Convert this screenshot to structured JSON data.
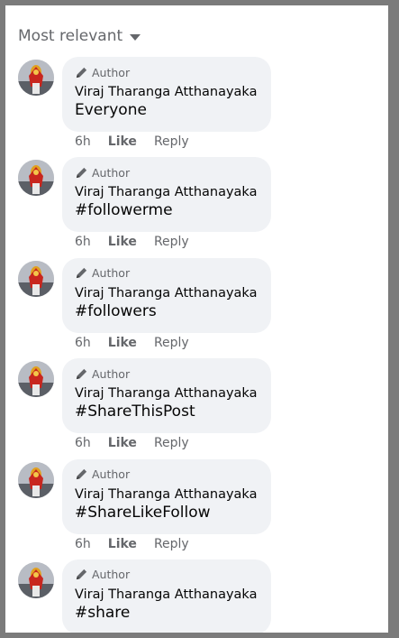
{
  "sort_label": "Most relevant",
  "comments": [
    {
      "author_badge": "Author",
      "author_name": "Viraj Tharanga Atthanayaka",
      "text": "Everyone",
      "time": "6h",
      "like_label": "Like",
      "reply_label": "Reply"
    },
    {
      "author_badge": "Author",
      "author_name": "Viraj Tharanga Atthanayaka",
      "text": "#followerme",
      "time": "6h",
      "like_label": "Like",
      "reply_label": "Reply"
    },
    {
      "author_badge": "Author",
      "author_name": "Viraj Tharanga Atthanayaka",
      "text": "#followers",
      "time": "6h",
      "like_label": "Like",
      "reply_label": "Reply"
    },
    {
      "author_badge": "Author",
      "author_name": "Viraj Tharanga Atthanayaka",
      "text": "#ShareThisPost",
      "time": "6h",
      "like_label": "Like",
      "reply_label": "Reply"
    },
    {
      "author_badge": "Author",
      "author_name": "Viraj Tharanga Atthanayaka",
      "text": "#ShareLikeFollow",
      "time": "6h",
      "like_label": "Like",
      "reply_label": "Reply"
    },
    {
      "author_badge": "Author",
      "author_name": "Viraj Tharanga Atthanayaka",
      "text": "#share",
      "time": "",
      "like_label": "",
      "reply_label": ""
    }
  ],
  "icons": {
    "author_badge": "pencil-icon",
    "sort": "chevron-down-icon"
  },
  "colors": {
    "bubble": "#f0f2f5",
    "secondary_text": "#65676b",
    "primary_text": "#050505"
  }
}
